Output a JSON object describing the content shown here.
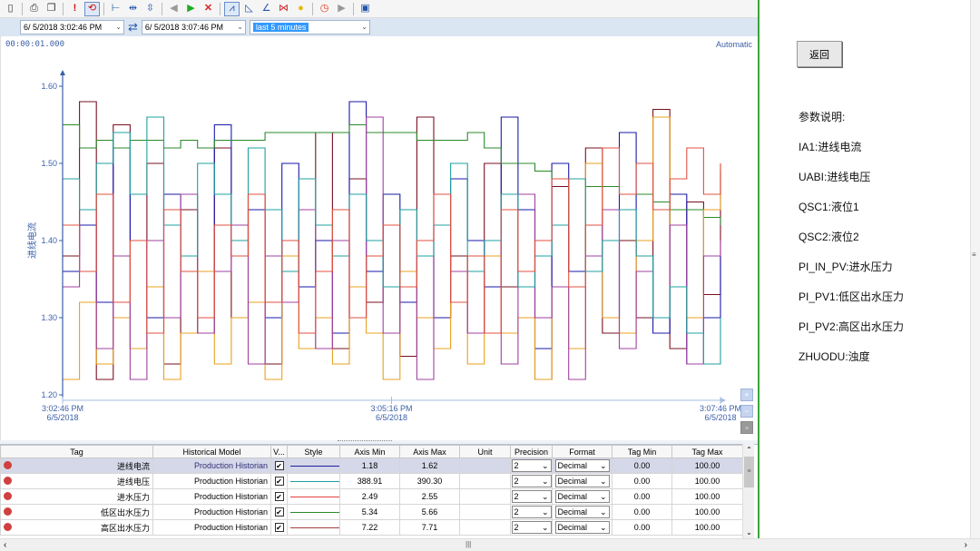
{
  "toolbar": {
    "icons": [
      "new-icon",
      "print-icon",
      "copy-icon",
      "alarm-icon",
      "refresh-icon",
      "time-range-icon",
      "pan-icon",
      "scale-icon",
      "back-icon",
      "forward-icon",
      "delete-icon",
      "trend-icon",
      "area-icon",
      "line-icon",
      "marker-icon",
      "bulb-icon",
      "clock-icon",
      "play-icon",
      "export-icon"
    ]
  },
  "timebar": {
    "start_time": "6/ 5/2018  3:02:46 PM",
    "end_time": "6/ 5/2018  3:07:46 PM",
    "duration_selected": "last 5 minutes"
  },
  "plot": {
    "timestamp": "00:00:01.000",
    "mode": "Automatic"
  },
  "colors": {
    "axis": "#3b5fa8",
    "series": [
      "#7a1020",
      "#1a1aaa",
      "#2a8a2a",
      "#e8a020",
      "#a040a0",
      "#20a0a0",
      "#e05040"
    ]
  },
  "chart_data": {
    "type": "line",
    "ylabel": "进线电流",
    "ylim": [
      1.2,
      1.6
    ],
    "yticks": [
      "1.20",
      "1.30",
      "1.40",
      "1.50",
      "1.60"
    ],
    "x_ticks": [
      {
        "time": "3:02:46 PM",
        "date": "6/5/2018"
      },
      {
        "time": "3:05:16 PM",
        "date": "6/5/2018"
      },
      {
        "time": "3:07:46 PM",
        "date": "6/5/2018"
      }
    ],
    "series": [
      {
        "color": "#7a1020",
        "values": [
          1.38,
          1.58,
          1.22,
          1.55,
          1.26,
          1.5,
          1.24,
          1.44,
          1.28,
          1.52,
          1.3,
          1.46,
          1.24,
          1.4,
          1.34,
          1.54,
          1.26,
          1.48,
          1.32,
          1.42,
          1.25,
          1.56,
          1.3,
          1.38,
          1.28,
          1.5,
          1.34,
          1.44,
          1.22,
          1.47,
          1.36,
          1.52,
          1.28,
          1.4,
          1.3,
          1.57,
          1.26,
          1.45,
          1.33,
          1.49
        ]
      },
      {
        "color": "#1a1aaa",
        "values": [
          1.36,
          1.42,
          1.32,
          1.52,
          1.4,
          1.3,
          1.46,
          1.36,
          1.28,
          1.55,
          1.38,
          1.44,
          1.3,
          1.5,
          1.34,
          1.4,
          1.28,
          1.58,
          1.36,
          1.46,
          1.32,
          1.38,
          1.3,
          1.48,
          1.4,
          1.34,
          1.56,
          1.44,
          1.26,
          1.5,
          1.36,
          1.42,
          1.3,
          1.54,
          1.38,
          1.28,
          1.46,
          1.24,
          1.3,
          1.38
        ]
      },
      {
        "color": "#2a8a2a",
        "values": [
          1.55,
          1.52,
          1.53,
          1.52,
          1.53,
          1.53,
          1.52,
          1.53,
          1.52,
          1.53,
          1.53,
          1.53,
          1.54,
          1.54,
          1.54,
          1.54,
          1.54,
          1.55,
          1.54,
          1.54,
          1.54,
          1.53,
          1.53,
          1.53,
          1.54,
          1.52,
          1.5,
          1.5,
          1.49,
          1.48,
          1.48,
          1.47,
          1.47,
          1.46,
          1.46,
          1.45,
          1.44,
          1.44,
          1.43,
          1.42
        ]
      },
      {
        "color": "#e8a020",
        "values": [
          1.22,
          1.32,
          1.24,
          1.3,
          1.26,
          1.34,
          1.22,
          1.28,
          1.36,
          1.24,
          1.3,
          1.32,
          1.22,
          1.38,
          1.26,
          1.3,
          1.24,
          1.34,
          1.28,
          1.22,
          1.36,
          1.3,
          1.26,
          1.32,
          1.24,
          1.38,
          1.28,
          1.3,
          1.22,
          1.34,
          1.26,
          1.5,
          1.3,
          1.28,
          1.4,
          1.56,
          1.34,
          1.3,
          1.44,
          1.5
        ]
      },
      {
        "color": "#a040a0",
        "values": [
          1.34,
          1.44,
          1.26,
          1.38,
          1.22,
          1.4,
          1.3,
          1.46,
          1.28,
          1.36,
          1.42,
          1.24,
          1.38,
          1.32,
          1.44,
          1.26,
          1.4,
          1.3,
          1.56,
          1.28,
          1.34,
          1.22,
          1.42,
          1.36,
          1.28,
          1.4,
          1.24,
          1.46,
          1.3,
          1.34,
          1.22,
          1.38,
          1.44,
          1.26,
          1.36,
          1.3,
          1.42,
          1.24,
          1.38,
          1.4
        ]
      },
      {
        "color": "#20a0a0",
        "values": [
          1.48,
          1.44,
          1.5,
          1.54,
          1.46,
          1.56,
          1.42,
          1.38,
          1.5,
          1.46,
          1.4,
          1.52,
          1.44,
          1.36,
          1.48,
          1.42,
          1.38,
          1.46,
          1.4,
          1.34,
          1.44,
          1.38,
          1.42,
          1.5,
          1.36,
          1.4,
          1.46,
          1.34,
          1.38,
          1.42,
          1.48,
          1.36,
          1.4,
          1.44,
          1.38,
          1.3,
          1.34,
          1.28,
          1.24,
          1.3
        ]
      },
      {
        "color": "#e05040",
        "values": [
          1.42,
          1.36,
          1.46,
          1.32,
          1.4,
          1.28,
          1.44,
          1.36,
          1.3,
          1.42,
          1.38,
          1.46,
          1.32,
          1.4,
          1.28,
          1.36,
          1.44,
          1.3,
          1.38,
          1.42,
          1.34,
          1.4,
          1.46,
          1.32,
          1.38,
          1.28,
          1.44,
          1.36,
          1.4,
          1.48,
          1.34,
          1.42,
          1.52,
          1.46,
          1.5,
          1.44,
          1.48,
          1.52,
          1.46,
          1.5
        ]
      }
    ]
  },
  "grid": {
    "columns": [
      "Tag",
      "Historical Model",
      "V...",
      "Style",
      "Axis Min",
      "Axis Max",
      "Unit",
      "Precision",
      "Format",
      "Tag Min",
      "Tag Max"
    ],
    "rows": [
      {
        "tag": "进线电流",
        "model": "Production Historian",
        "style_color": "#2020a0",
        "axis_min": "1.18",
        "axis_max": "1.62",
        "unit": "",
        "precision": "2",
        "format": "Decimal",
        "tag_min": "0.00",
        "tag_max": "100.00"
      },
      {
        "tag": "进线电压",
        "model": "Production Historian",
        "style_color": "#20a0a0",
        "axis_min": "388.91",
        "axis_max": "390.30",
        "unit": "",
        "precision": "2",
        "format": "Decimal",
        "tag_min": "0.00",
        "tag_max": "100.00"
      },
      {
        "tag": "进水压力",
        "model": "Production Historian",
        "style_color": "#e04040",
        "axis_min": "2.49",
        "axis_max": "2.55",
        "unit": "",
        "precision": "2",
        "format": "Decimal",
        "tag_min": "0.00",
        "tag_max": "100.00"
      },
      {
        "tag": "低区出水压力",
        "model": "Production Historian",
        "style_color": "#2a8a2a",
        "axis_min": "5.34",
        "axis_max": "5.66",
        "unit": "",
        "precision": "2",
        "format": "Decimal",
        "tag_min": "0.00",
        "tag_max": "100.00"
      },
      {
        "tag": "高区出水压力",
        "model": "Production Historian",
        "style_color": "#a04040",
        "axis_min": "7.22",
        "axis_max": "7.71",
        "unit": "",
        "precision": "2",
        "format": "Decimal",
        "tag_min": "0.00",
        "tag_max": "100.00"
      }
    ]
  },
  "side": {
    "back_label": "返回",
    "heading": "参数说明:",
    "items": [
      "IA1:进线电流",
      "UABI:进线电压",
      "QSC1:液位1",
      "QSC2:液位2",
      "PI_IN_PV:进水压力",
      "PI_PV1:低区出水压力",
      "PI_PV2:高区出水压力",
      "ZHUODU:浊度"
    ]
  }
}
